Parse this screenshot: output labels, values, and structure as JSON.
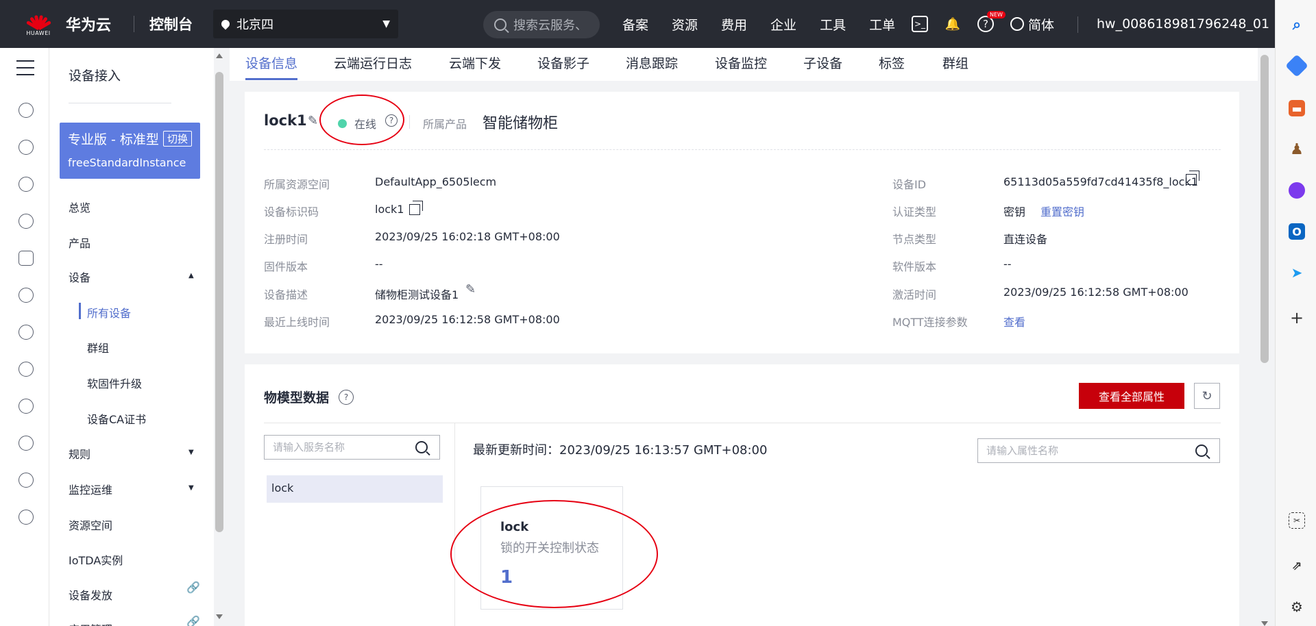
{
  "topbar": {
    "brand_name": "华为云",
    "brand_caption": "HUAWEI",
    "console": "控制台",
    "region": "北京四",
    "search_placeholder": "搜索云服务、",
    "nav": [
      "备案",
      "资源",
      "费用",
      "企业",
      "工具",
      "工单"
    ],
    "new_badge": "NEW",
    "language": "简体",
    "account": "hw_008618981796248_01"
  },
  "menu": {
    "title": "设备接入",
    "instance_edition": "专业版 - 标准型",
    "instance_switch": "切换",
    "instance_name": "freeStandardInstance",
    "items": {
      "overview": "总览",
      "product": "产品",
      "device": "设备",
      "all_devices": "所有设备",
      "group": "群组",
      "firmware": "软固件升级",
      "ca_cert": "设备CA证书",
      "rules": "规则",
      "monitor": "监控运维",
      "resource_space": "资源空间",
      "iotda_instance": "IoTDA实例",
      "provision": "设备发放",
      "more": "应用管理"
    }
  },
  "tabs": [
    "设备信息",
    "云端运行日志",
    "云端下发",
    "设备影子",
    "消息跟踪",
    "设备监控",
    "子设备",
    "标签",
    "群组"
  ],
  "device": {
    "name": "lock1",
    "status": "在线",
    "product_label": "所属产品",
    "product_value": "智能储物柜",
    "left": [
      {
        "label": "所属资源空间",
        "value": "DefaultApp_6505lecm"
      },
      {
        "label": "设备标识码",
        "value": "lock1"
      },
      {
        "label": "注册时间",
        "value": "2023/09/25 16:02:18 GMT+08:00"
      },
      {
        "label": "固件版本",
        "value": "--"
      },
      {
        "label": "设备描述",
        "value": "储物柜测试设备1"
      },
      {
        "label": "最近上线时间",
        "value": "2023/09/25 16:12:58 GMT+08:00"
      }
    ],
    "right": [
      {
        "label": "设备ID",
        "value": "65113d05a559fd7cd41435f8_lock1"
      },
      {
        "label": "认证类型",
        "value": "密钥",
        "link": "重置密钥"
      },
      {
        "label": "节点类型",
        "value": "直连设备"
      },
      {
        "label": "软件版本",
        "value": "--"
      },
      {
        "label": "激活时间",
        "value": "2023/09/25 16:12:58 GMT+08:00"
      },
      {
        "label": "MQTT连接参数",
        "value": "查看"
      }
    ]
  },
  "thing_model": {
    "title": "物模型数据",
    "view_all_button": "查看全部属性",
    "service_search_placeholder": "请输入服务名称",
    "services": [
      "lock"
    ],
    "last_update_label": "最新更新时间：",
    "last_update_value": "2023/09/25 16:13:57 GMT+08:00",
    "property_search_placeholder": "请输入属性名称",
    "property": {
      "name": "lock",
      "description": "锁的开关控制状态",
      "value": "1"
    }
  },
  "colors": {
    "topbar_bg": "#282b33",
    "accent": "#526ecc",
    "instance_bg": "#5e7ce0",
    "primary_button": "#c7000b",
    "status_online": "#50d4ab",
    "annotation": "#e60012"
  }
}
